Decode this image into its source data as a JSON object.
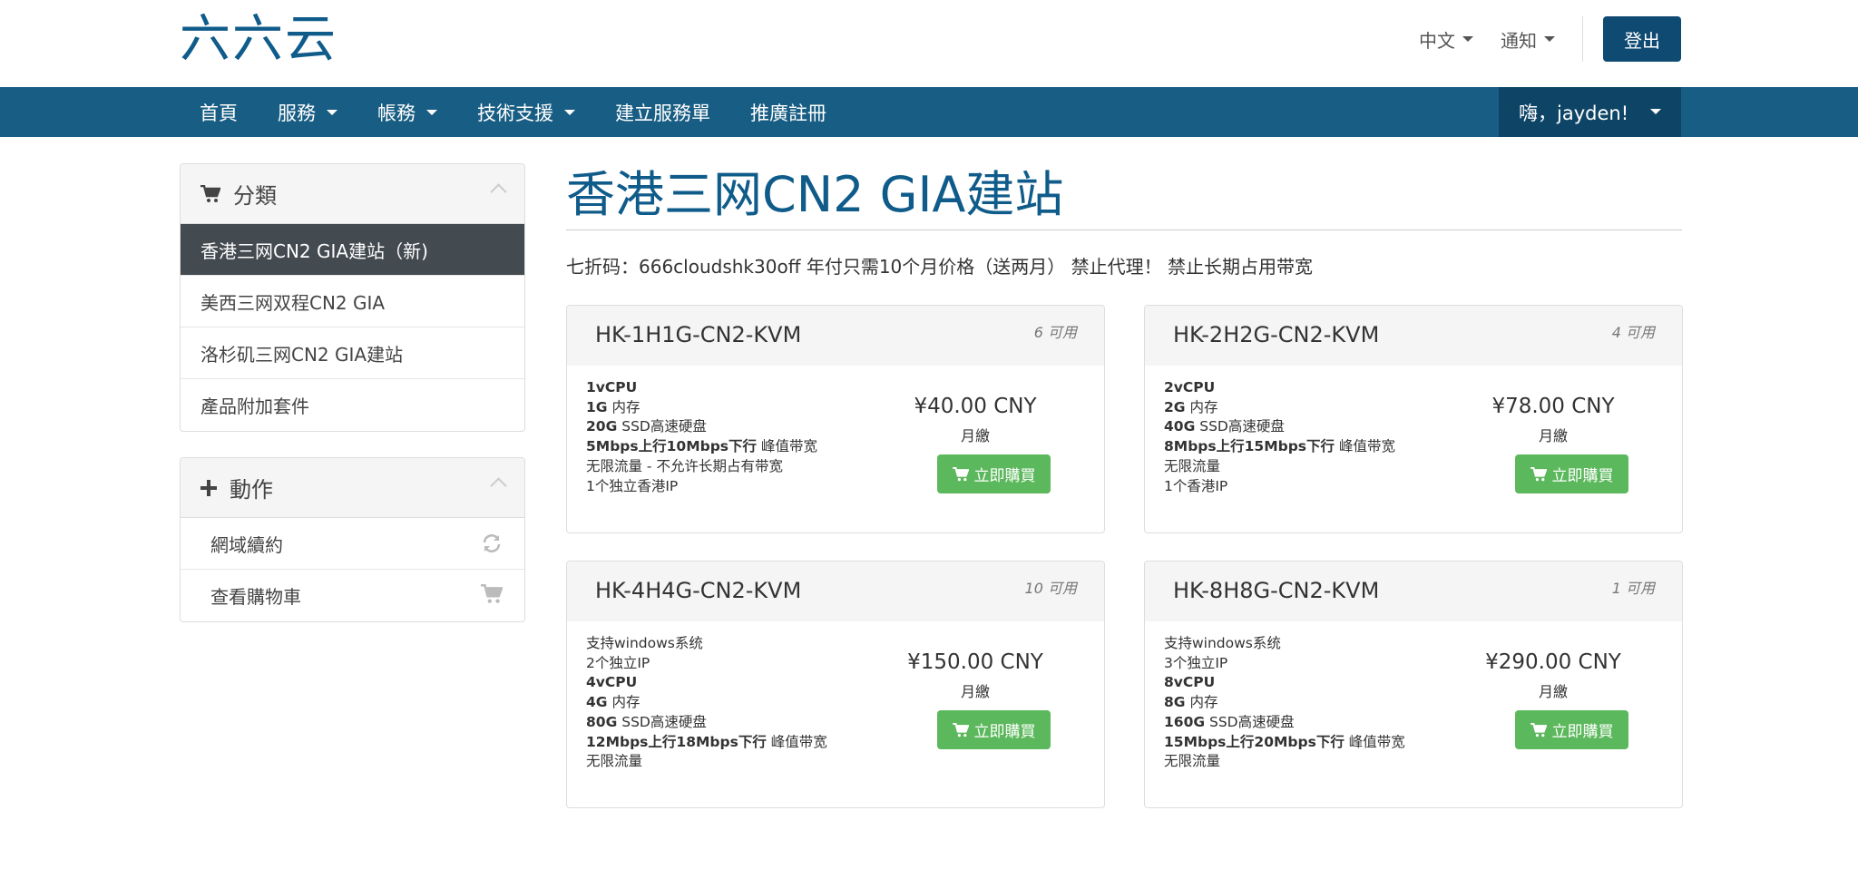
{
  "header": {
    "logo": "六六云",
    "language": "中文",
    "notifications": "通知",
    "logout": "登出"
  },
  "nav": {
    "items": [
      {
        "label": "首頁",
        "dropdown": false
      },
      {
        "label": "服務",
        "dropdown": true
      },
      {
        "label": "帳務",
        "dropdown": true
      },
      {
        "label": "技術支援",
        "dropdown": true
      },
      {
        "label": "建立服務單",
        "dropdown": false
      },
      {
        "label": "推廣註冊",
        "dropdown": false
      }
    ],
    "user": "嗨，jayden!"
  },
  "sidebar": {
    "categories_title": "分類",
    "categories": [
      {
        "label": "香港三网CN2 GIA建站（新)",
        "active": true
      },
      {
        "label": "美西三网双程CN2 GIA",
        "active": false
      },
      {
        "label": "洛杉矶三网CN2 GIA建站",
        "active": false
      },
      {
        "label": "產品附加套件",
        "active": false
      }
    ],
    "actions_title": "動作",
    "actions": [
      {
        "label": "網域續約",
        "icon": "refresh-icon"
      },
      {
        "label": "查看購物車",
        "icon": "cart-icon"
      }
    ]
  },
  "main": {
    "title": "香港三网CN2 GIA建站",
    "promo": "七折码：666cloudshk30off 年付只需10个月价格（送两月） 禁止代理！ 禁止长期占用带宽"
  },
  "products": [
    {
      "name": "HK-1H1G-CN2-KVM",
      "qty": "6 可用",
      "features": [
        {
          "bold": "1vCPU",
          "rest": ""
        },
        {
          "bold": "1G",
          "rest": " 内存"
        },
        {
          "bold": "20G",
          "rest": " SSD高速硬盘"
        },
        {
          "bold": "5Mbps上行10Mbps下行",
          "rest": " 峰值带宽"
        },
        {
          "bold": "",
          "rest": "无限流量 - 不允许长期占有带宽"
        },
        {
          "bold": "",
          "rest": "1个独立香港IP"
        }
      ],
      "price": "¥40.00 CNY",
      "cycle": "月繳",
      "buy": "立即購買"
    },
    {
      "name": "HK-2H2G-CN2-KVM",
      "qty": "4 可用",
      "features": [
        {
          "bold": "2vCPU",
          "rest": ""
        },
        {
          "bold": "2G",
          "rest": " 内存"
        },
        {
          "bold": "40G",
          "rest": " SSD高速硬盘"
        },
        {
          "bold": "8Mbps上行15Mbps下行",
          "rest": " 峰值带宽"
        },
        {
          "bold": "",
          "rest": "无限流量"
        },
        {
          "bold": "",
          "rest": "1个香港IP"
        }
      ],
      "price": "¥78.00 CNY",
      "cycle": "月繳",
      "buy": "立即購買"
    },
    {
      "name": "HK-4H4G-CN2-KVM",
      "qty": "10 可用",
      "features": [
        {
          "bold": "",
          "rest": "支持windows系统"
        },
        {
          "bold": "",
          "rest": "2个独立IP"
        },
        {
          "bold": "4vCPU",
          "rest": ""
        },
        {
          "bold": "4G",
          "rest": " 内存"
        },
        {
          "bold": "80G",
          "rest": " SSD高速硬盘"
        },
        {
          "bold": "12Mbps上行18Mbps下行",
          "rest": " 峰值带宽"
        },
        {
          "bold": "",
          "rest": "无限流量"
        }
      ],
      "price": "¥150.00 CNY",
      "cycle": "月繳",
      "buy": "立即購買"
    },
    {
      "name": "HK-8H8G-CN2-KVM",
      "qty": "1 可用",
      "features": [
        {
          "bold": "",
          "rest": "支持windows系统"
        },
        {
          "bold": "",
          "rest": "3个独立IP"
        },
        {
          "bold": "8vCPU",
          "rest": ""
        },
        {
          "bold": "8G",
          "rest": " 内存"
        },
        {
          "bold": "160G",
          "rest": " SSD高速硬盘"
        },
        {
          "bold": "15Mbps上行20Mbps下行",
          "rest": " 峰值带宽"
        },
        {
          "bold": "",
          "rest": "无限流量"
        }
      ],
      "price": "¥290.00 CNY",
      "cycle": "月繳",
      "buy": "立即購買"
    }
  ],
  "colors": {
    "brand": "#0f5b8a",
    "nav": "#185d83",
    "buy": "#5cb85c",
    "active": "#434a50"
  }
}
